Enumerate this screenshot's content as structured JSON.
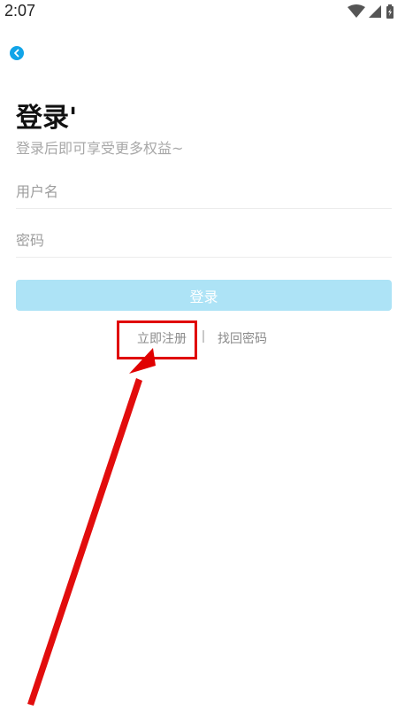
{
  "status_bar": {
    "time": "2:07",
    "icons": [
      "wifi-icon",
      "signal-icon",
      "battery-icon"
    ]
  },
  "header": {
    "back_icon": "chevron-left-icon"
  },
  "login": {
    "title": "登录'",
    "subtitle": "登录后即可享受更多权益~",
    "username_placeholder": "用户名",
    "password_placeholder": "密码",
    "submit_label": "登录",
    "register_link": "立即注册",
    "forgot_link": "找回密码"
  },
  "annotation": {
    "highlight_color": "#e00000",
    "target": "register-link"
  },
  "colors": {
    "accent": "#11a4e8",
    "button_bg": "#ade3f6"
  }
}
